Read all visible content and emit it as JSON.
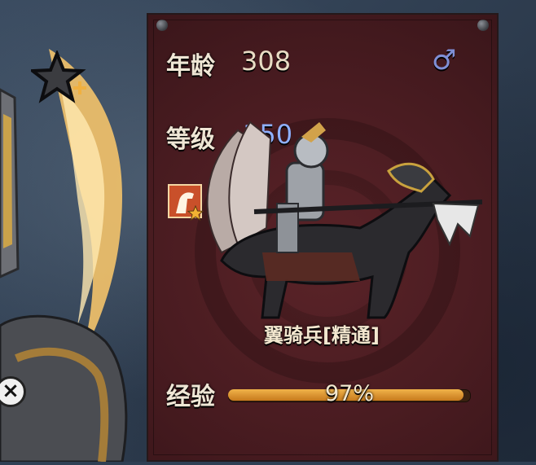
{
  "stats": {
    "age_label": "年龄",
    "age_value": "308",
    "level_label": "等级",
    "level_value": "150",
    "exp_label": "经验",
    "exp_percent_text": "97%",
    "exp_fraction": 0.97
  },
  "unit": {
    "name": "翼骑兵[精通]"
  },
  "colors": {
    "panel": "#4a1c21",
    "level_value": "#8fb0ff",
    "age_value": "#e8dcc4",
    "exp_fill": "#e19a2f",
    "gender_icon": "#7f8fd6"
  },
  "icons": {
    "gender": "male-icon",
    "class_badge": "cavalry-badge-icon",
    "star_add": "star-plus-icon",
    "close": "close-icon"
  }
}
